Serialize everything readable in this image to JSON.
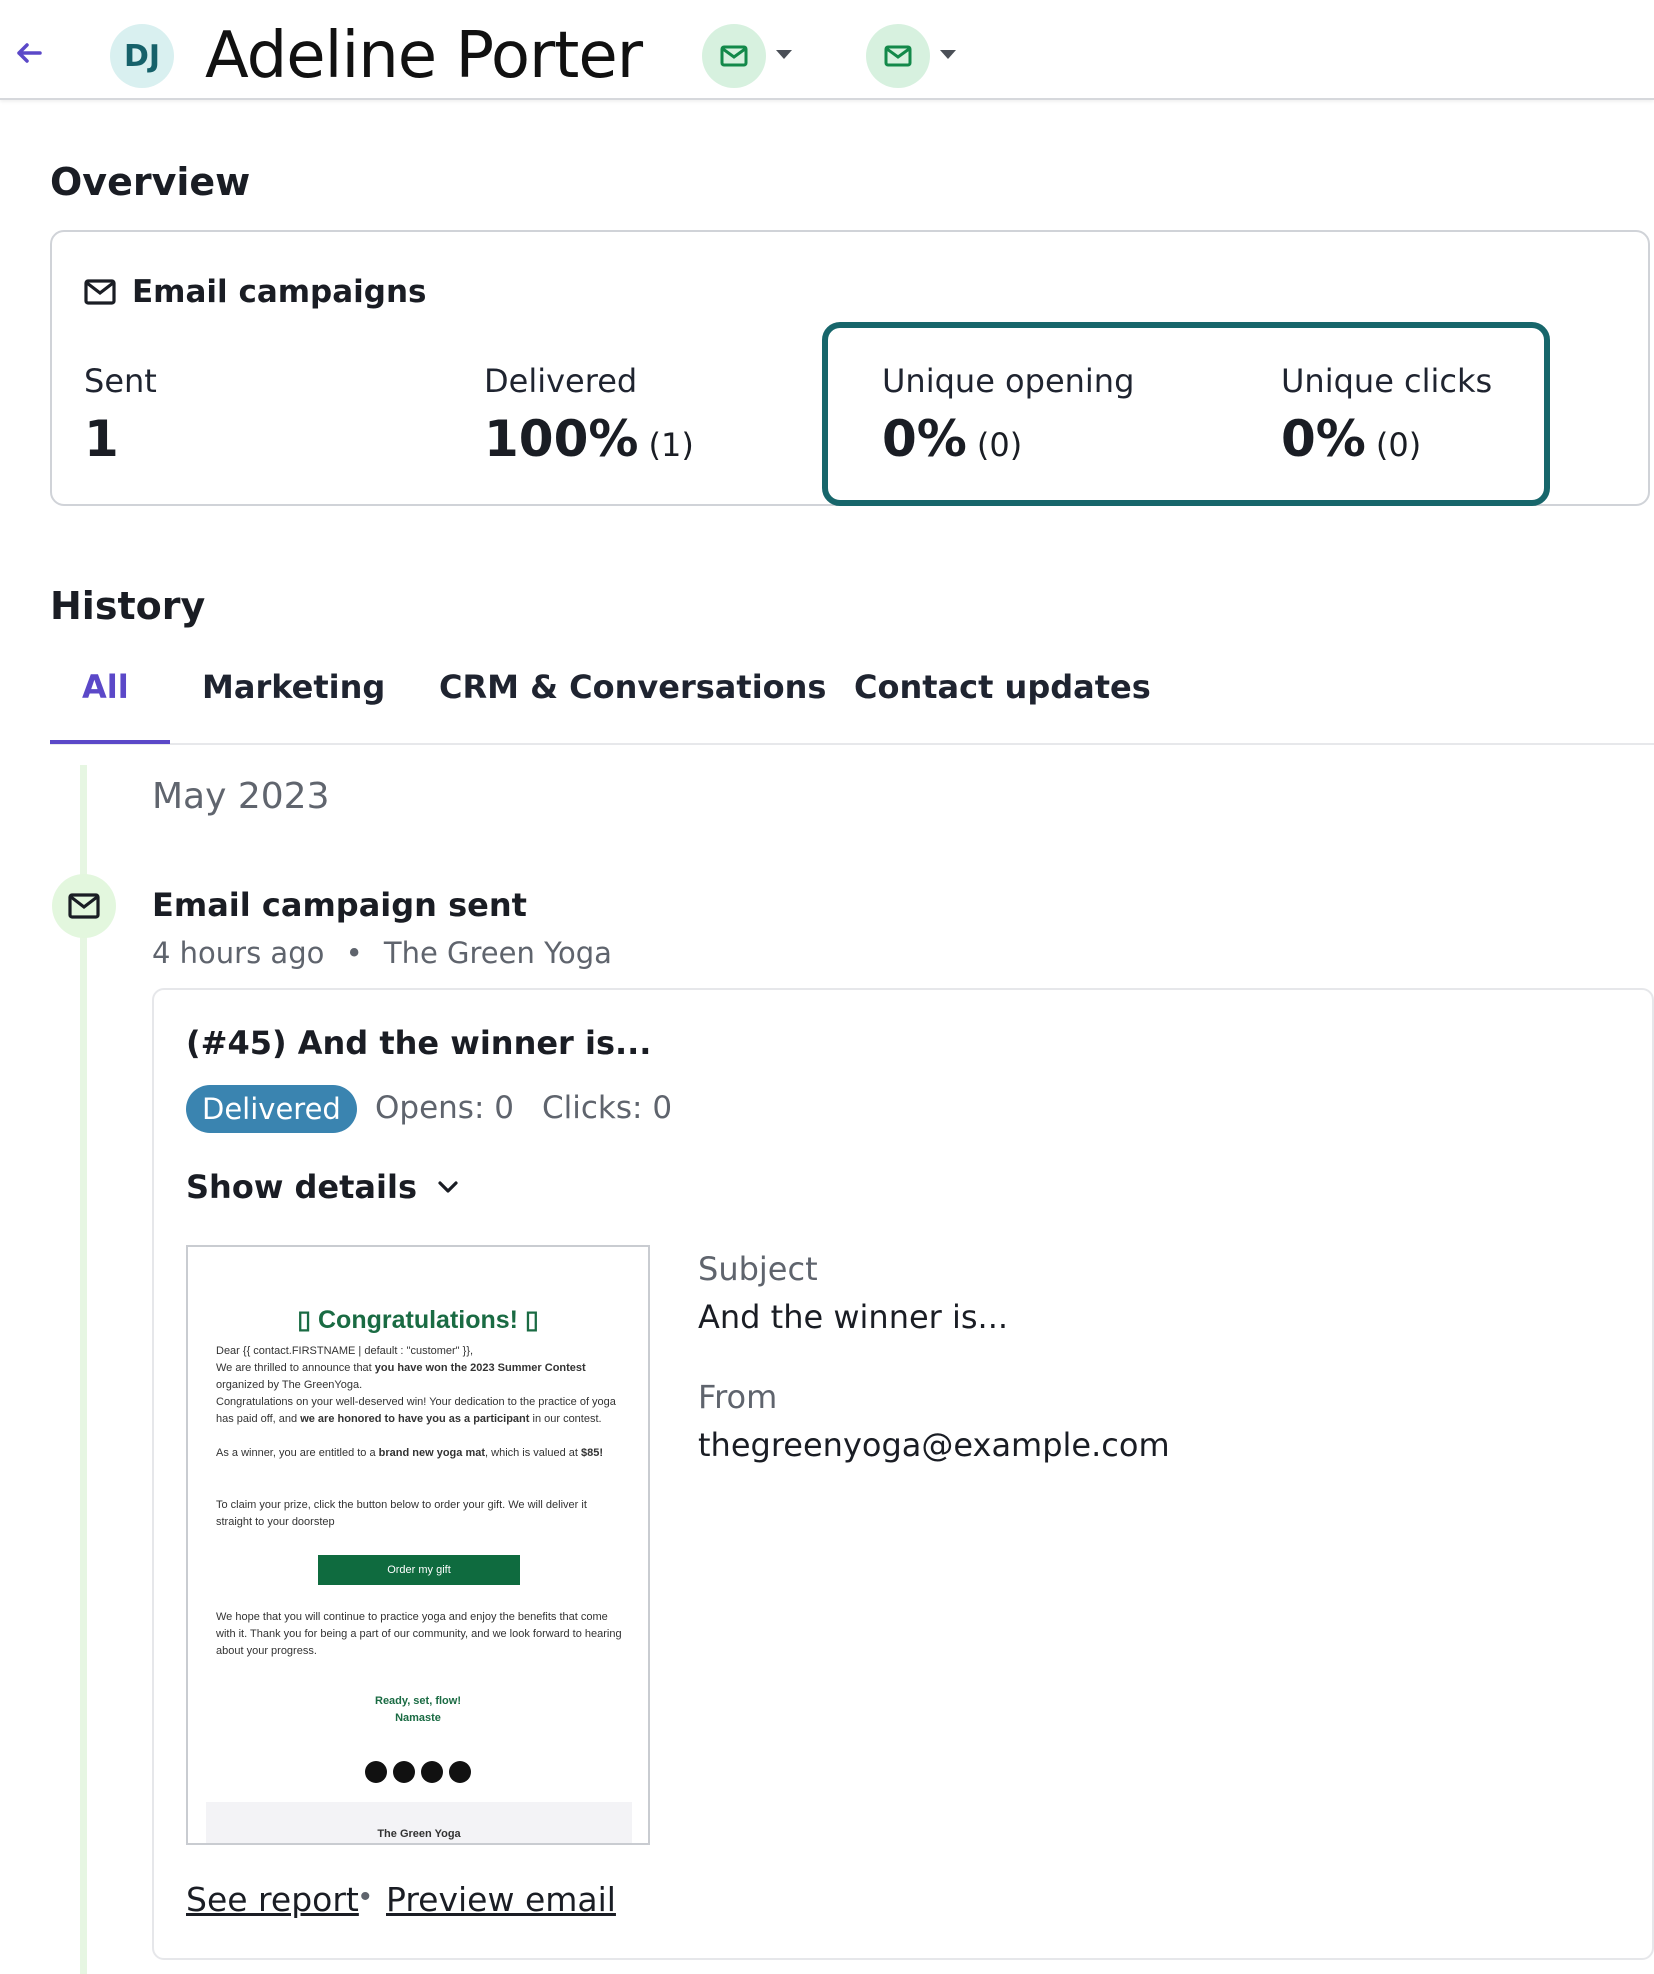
{
  "header": {
    "avatar_initials": "DJ",
    "contact_name": "Adeline Porter",
    "icons": [
      "back-arrow-icon",
      "mail-icon",
      "mail-icon"
    ]
  },
  "overview": {
    "title": "Overview",
    "card_title": "Email campaigns",
    "stats": [
      {
        "label": "Sent",
        "value": "1",
        "count": ""
      },
      {
        "label": "Delivered",
        "value": "100%",
        "count": "(1)"
      },
      {
        "label": "Unique opening",
        "value": "0%",
        "count": "(0)"
      },
      {
        "label": "Unique clicks",
        "value": "0%",
        "count": "(0)"
      }
    ]
  },
  "history": {
    "title": "History",
    "tabs": [
      {
        "label": "All",
        "active": true
      },
      {
        "label": "Marketing"
      },
      {
        "label": "CRM & Conversations"
      },
      {
        "label": "Contact updates"
      }
    ],
    "month": "May 2023",
    "event": {
      "title": "Email campaign sent",
      "time": "4 hours ago",
      "separator": "•",
      "sender_name": "The Green Yoga",
      "campaign_title": "(#45) And the winner is...",
      "status": "Delivered",
      "opens": "Opens: 0",
      "clicks": "Clicks: 0",
      "show_details": "Show details",
      "subject_label": "Subject",
      "subject_value": "And the winner is...",
      "from_label": "From",
      "from_value": "thegreenyoga@example.com",
      "see_report": "See report",
      "preview_email": "Preview email"
    },
    "preview": {
      "heading": "Congratulations!",
      "heading_icon": "▯",
      "p1": "Dear {{ contact.FIRSTNAME | default : \"customer\" }},",
      "p2a": "We are thrilled to announce that ",
      "p2b": "you have won the 2023 Summer Contest",
      "p2c": " organized by The GreenYoga.",
      "p3a": "Congratulations on your well-deserved win! Your dedication to the practice of yoga has paid off, and ",
      "p3b": "we are honored to have you as a participant",
      "p3c": " in our contest.",
      "p4a": "As a winner, you are entitled to a ",
      "p4b": "brand new yoga mat",
      "p4c": ", which is valued at ",
      "p4d": "$85!",
      "p5": "To claim your prize, click the button below to order your gift. We will deliver it straight to your doorstep",
      "button": "Order my gift",
      "p6": "We hope that you will continue to practice yoga and enjoy the benefits that come with it. Thank you for being a part of our community, and we look forward to hearing about your progress.",
      "closing1": "Ready, set, flow!",
      "closing2": "Namaste",
      "footer": "The Green Yoga",
      "social_icons": [
        "instagram-icon",
        "facebook-icon",
        "website-icon",
        "twitter-icon"
      ]
    }
  },
  "colors": {
    "accent": "#5b48c8",
    "highlight_border": "#17666b",
    "badge": "#3a84b0",
    "brand_green": "#0f6b3f"
  }
}
